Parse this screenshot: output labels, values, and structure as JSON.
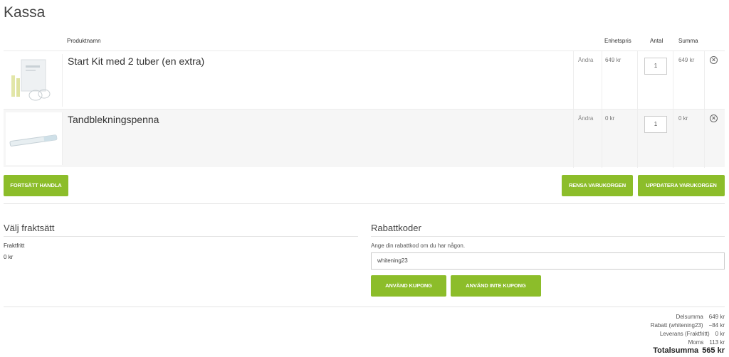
{
  "page": {
    "title": "Kassa"
  },
  "columns": {
    "product": "Produktnamn",
    "unit_price": "Enhetspris",
    "qty": "Antal",
    "sum": "Summa"
  },
  "items": [
    {
      "name": "Start Kit med 2 tuber (en extra)",
      "edit": "Ändra",
      "unit_price": "649 kr",
      "qty": "1",
      "sum": "649 kr"
    },
    {
      "name": "Tandblekningspenna",
      "edit": "Ändra",
      "unit_price": "0 kr",
      "qty": "1",
      "sum": "0 kr"
    }
  ],
  "cart_buttons": {
    "continue": "FORTSÄTT HANDLA",
    "clear": "RENSA VARUKORGEN",
    "update": "UPPDATERA VARUKORGEN"
  },
  "shipping": {
    "title": "Välj fraktsätt",
    "method": "Fraktfritt",
    "price": "0 kr"
  },
  "coupon": {
    "title": "Rabattkoder",
    "hint": "Ange din rabattkod om du har någon.",
    "value": "whitening23",
    "apply": "ANVÄND KUPONG",
    "cancel": "ANVÄND INTE KUPONG"
  },
  "totals": {
    "subtotal_label": "Delsumma",
    "subtotal": "649 kr",
    "discount_label": "Rabatt (whitening23)",
    "discount": "−84 kr",
    "shipping_label": "Leverans (Fraktfritt)",
    "shipping": "0 kr",
    "tax_label": "Moms",
    "tax": "113 kr",
    "grand_label": "Totalsumma",
    "grand": "565 kr"
  },
  "colors": {
    "accent": "#8cbd2a",
    "row_alt": "#f6f6f6"
  }
}
